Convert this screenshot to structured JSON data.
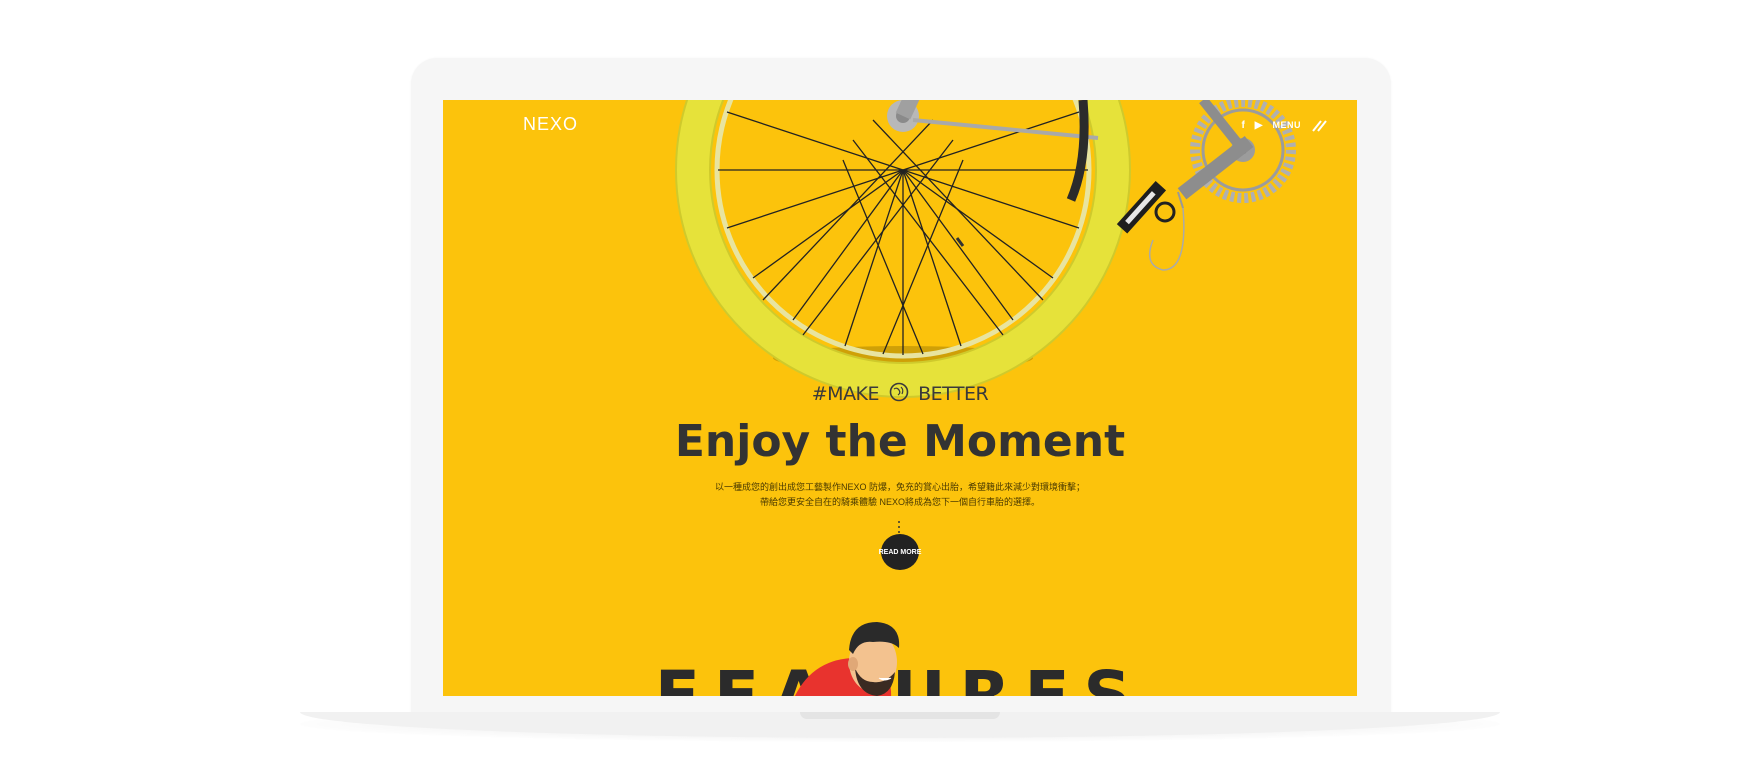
{
  "brand": {
    "logo_text": "NEXO"
  },
  "nav": {
    "social": [
      "f",
      "▶"
    ],
    "menu_label": "MENU"
  },
  "hero": {
    "hashtag_left": "#MAKE",
    "hashtag_right": "BETTER",
    "headline": "Enjoy the Moment",
    "description_line1": "以一種成您的創出成您工藝製作NEXO 防爆，免充的賞心出胎，希望籍此來減少對環境衝擊；",
    "description_line2": "帶給您更安全自在的騎乘體驗 NEXO將成為您下一個自行車胎的選擇。",
    "read_more_label": "READ MORE"
  },
  "next_section": {
    "title": "FEATURES"
  },
  "colors": {
    "accent": "#fcc30c",
    "dark": "#333333",
    "rider_shirt": "#e8332e",
    "tire": "#e6e23a"
  }
}
